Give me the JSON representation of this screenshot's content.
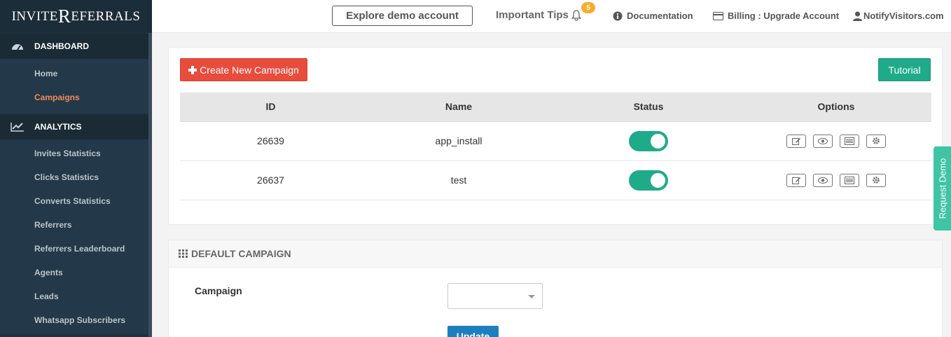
{
  "logo": {
    "part1": "INVITE",
    "part2": "R",
    "part3": "EFERRALS"
  },
  "sidebar": {
    "dashboard_label": "DASHBOARD",
    "dashboard_items": [
      "Home",
      "Campaigns"
    ],
    "analytics_label": "ANALYTICS",
    "analytics_items": [
      "Invites Statistics",
      "Clicks Statistics",
      "Converts Statistics",
      "Referrers",
      "Referrers Leaderboard",
      "Agents",
      "Leads",
      "Whatsapp Subscribers"
    ]
  },
  "topbar": {
    "demo_button": "Explore demo account",
    "tips_label": "Important Tips",
    "tips_badge": "5",
    "documentation": "Documentation",
    "billing": "Billing : Upgrade Account",
    "account": "NotifyVisitors.com"
  },
  "campaigns": {
    "create_button": "Create New Campaign",
    "tutorial_button": "Tutorial",
    "columns": [
      "ID",
      "Name",
      "Status",
      "Options"
    ],
    "rows": [
      {
        "id": "26639",
        "name": "app_install",
        "status": "on"
      },
      {
        "id": "26637",
        "name": "test",
        "status": "on"
      }
    ]
  },
  "default_campaign": {
    "header": "DEFAULT CAMPAIGN",
    "field_label": "Campaign",
    "selected_value": "",
    "update_button": "Update"
  },
  "request_demo": "Request Demo",
  "colors": {
    "sidebar": "#1f3240",
    "accent_green": "#1fab89",
    "danger_red": "#e84c3d",
    "active_orange": "#f28a5c",
    "primary_blue": "#1e7fc0"
  }
}
